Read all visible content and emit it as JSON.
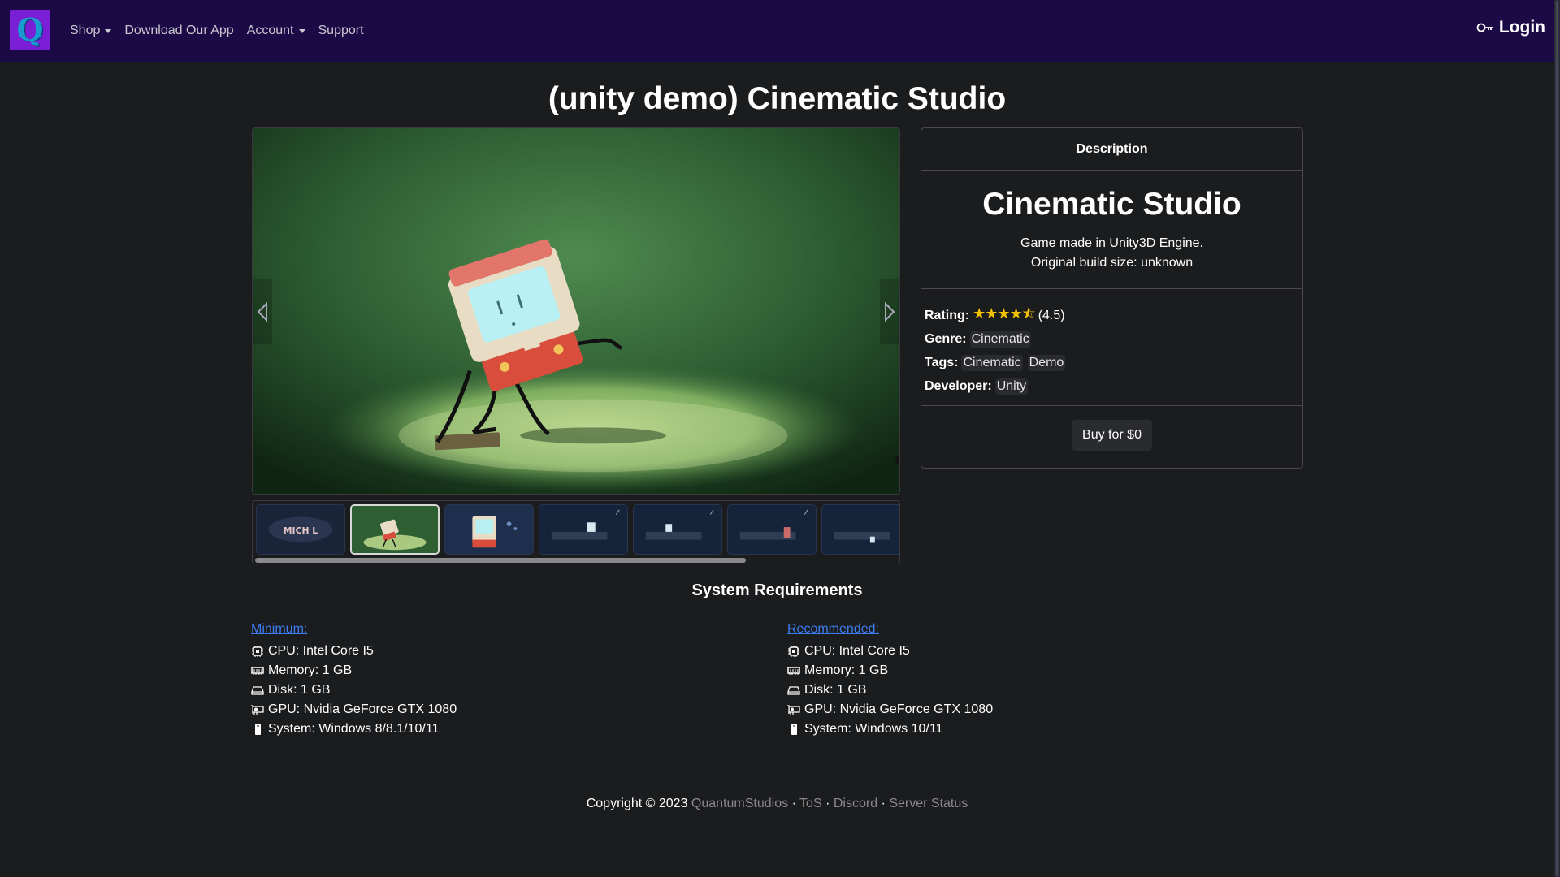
{
  "nav": {
    "logo_letter": "Q",
    "items": [
      {
        "label": "Shop",
        "dropdown": true
      },
      {
        "label": "Download Our App",
        "dropdown": false
      },
      {
        "label": "Account",
        "dropdown": true
      },
      {
        "label": "Support",
        "dropdown": false
      }
    ],
    "login_label": "Login",
    "login_icon": "key-icon"
  },
  "page": {
    "title": "(unity demo) Cinematic Studio"
  },
  "carousel": {
    "active_index": 1,
    "thumbnail_count": 7,
    "thumb_labels": [
      "MICH L"
    ]
  },
  "description": {
    "header": "Description",
    "name": "Cinematic Studio",
    "line1": "Game made in Unity3D Engine.",
    "line2": "Original build size: unknown",
    "rating_label": "Rating:",
    "rating_value": 4.5,
    "rating_text": "(4.5)",
    "genre_label": "Genre:",
    "genre": "Cinematic",
    "tags_label": "Tags:",
    "tags": [
      "Cinematic",
      "Demo"
    ],
    "developer_label": "Developer:",
    "developer": "Unity",
    "buy_label": "Buy for $0"
  },
  "requirements": {
    "title": "System Requirements",
    "minimum": {
      "heading": "Minimum:",
      "cpu": "CPU: Intel Core I5",
      "memory": "Memory: 1 GB",
      "disk": "Disk: 1 GB",
      "gpu": "GPU: Nvidia GeForce GTX 1080",
      "system": "System: Windows 8/8.1/10/11"
    },
    "recommended": {
      "heading": "Recommended:",
      "cpu": "CPU: Intel Core I5",
      "memory": "Memory: 1 GB",
      "disk": "Disk: 1 GB",
      "gpu": "GPU: Nvidia GeForce GTX 1080",
      "system": "System: Windows 10/11"
    }
  },
  "footer": {
    "copyright": "Copyright © 2023",
    "brand": "QuantumStudios",
    "tos": "ToS",
    "discord": "Discord",
    "status": "Server Status",
    "sep": "·"
  },
  "colors": {
    "navbar": "#1b0a45",
    "background": "#1b1c1e",
    "logo": "#7a1fd6",
    "link": "#3d7cf0",
    "star": "#f2c200"
  }
}
